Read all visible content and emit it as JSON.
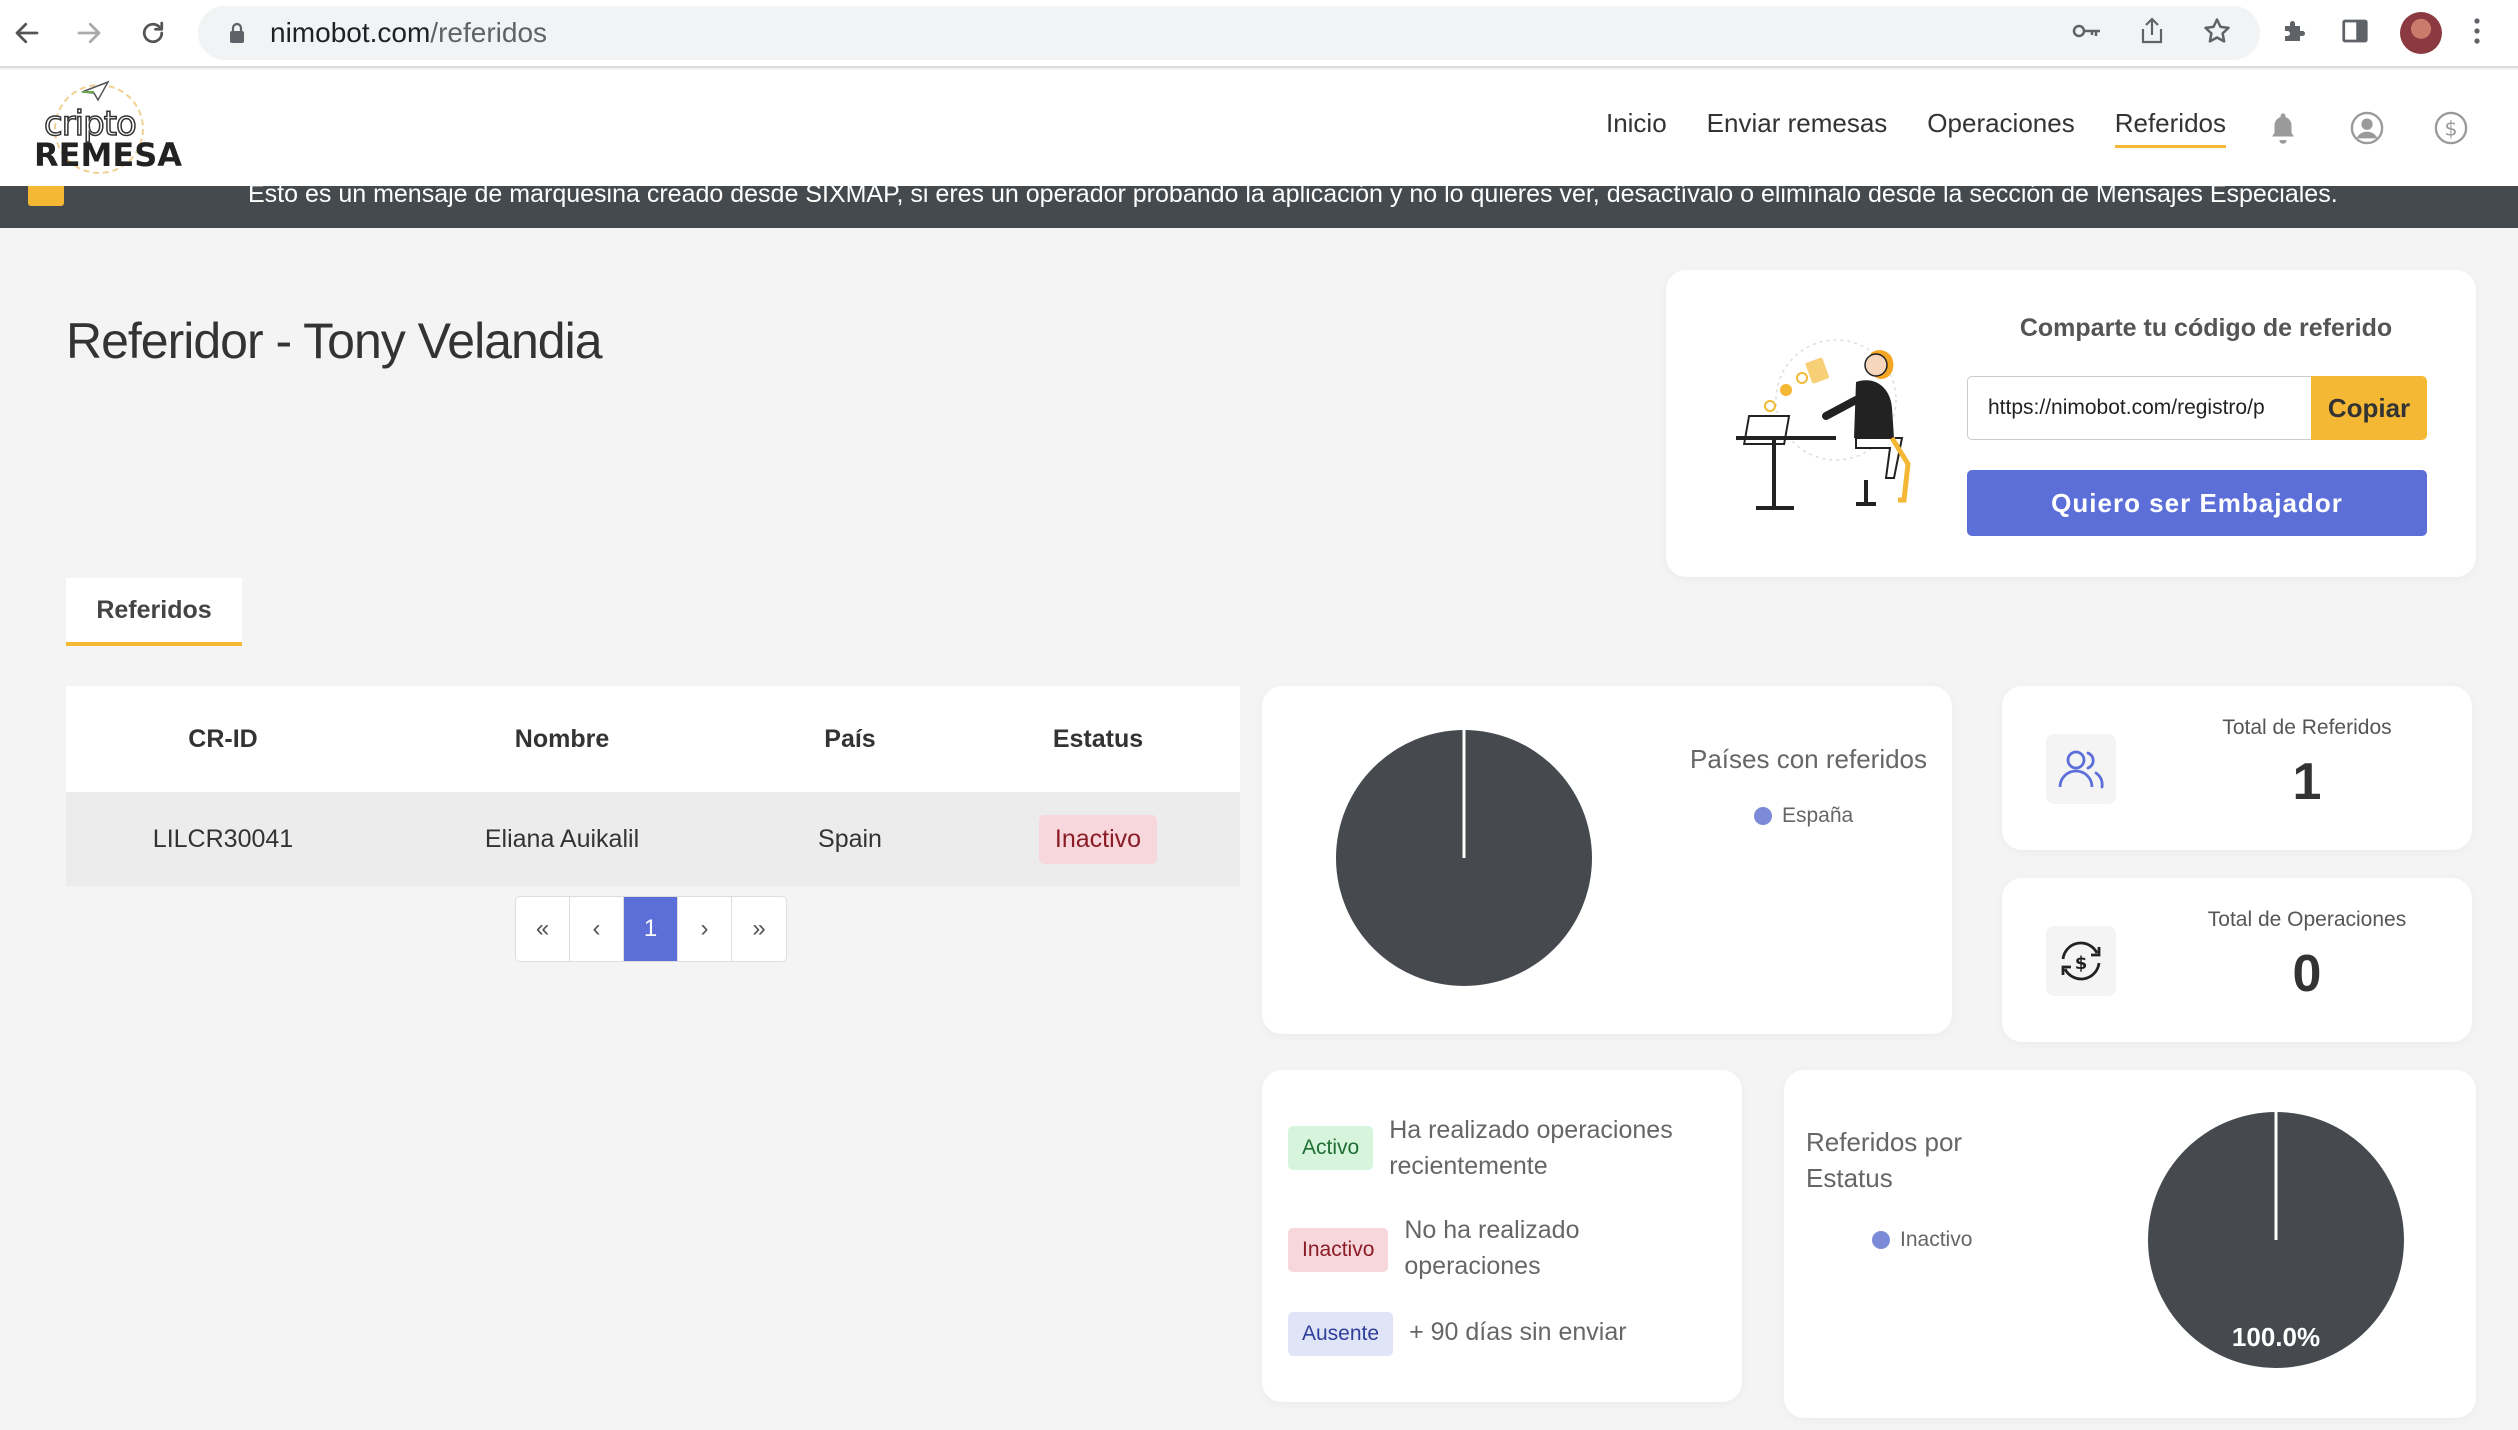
{
  "browser": {
    "url_domain": "nimobot.com",
    "url_path": "/referidos"
  },
  "site": {
    "logo_top": "cripto",
    "logo_bottom": "REMESA",
    "nav": [
      "Inicio",
      "Enviar remesas",
      "Operaciones",
      "Referidos"
    ],
    "active_nav": "Referidos"
  },
  "marquee": {
    "text": "Esto es un mensaje de marquesina creado desde SIXMAP, si eres un operador probando la aplicación y no lo quieres ver, desactívalo o elimínalo desde la sección de Mensajes Especiales."
  },
  "page": {
    "title": "Referidor - Tony Velandia"
  },
  "share": {
    "title": "Comparte tu código de referido",
    "link_value": "https://nimobot.com/registro/p",
    "copy_label": "Copiar",
    "ambassador_label": "Quiero ser Embajador"
  },
  "tabs": [
    "Referidos"
  ],
  "table": {
    "headers": [
      "CR-ID",
      "Nombre",
      "País",
      "Estatus"
    ],
    "rows": [
      {
        "id": "LILCR30041",
        "name": "Eliana Auikalil",
        "country": "Spain",
        "status": "Inactivo"
      }
    ]
  },
  "pagination": {
    "first": "«",
    "prev": "‹",
    "current": "1",
    "next": "›",
    "last": "»"
  },
  "countries_chart": {
    "title": "Países con referidos",
    "legend": [
      "España"
    ]
  },
  "stats": {
    "total_referidos_label": "Total de Referidos",
    "total_referidos_value": "1",
    "total_operaciones_label": "Total de Operaciones",
    "total_operaciones_value": "0"
  },
  "status_legend": [
    {
      "badge": "Activo",
      "text": "Ha realizado operaciones recientemente",
      "bg": "#d6f5dc",
      "fg": "#1f6e33"
    },
    {
      "badge": "Inactivo",
      "text": "No ha realizado operaciones",
      "bg": "#f7d7db",
      "fg": "#8a1c26"
    },
    {
      "badge": "Ausente",
      "text": "+ 90 días sin enviar",
      "bg": "#e0e4f7",
      "fg": "#2f3f99"
    }
  ],
  "status_chart": {
    "title": "Referidos por Estatus",
    "legend": [
      "Inactivo"
    ],
    "label": "100.0%"
  },
  "colors": {
    "accent": "#f5b835",
    "primary": "#5c6fd9",
    "pie_fill": "#464a4e",
    "legend_dot": "#7d8ad8"
  },
  "chart_data": [
    {
      "type": "pie",
      "title": "Países con referidos",
      "categories": [
        "España"
      ],
      "values": [
        1
      ]
    },
    {
      "type": "pie",
      "title": "Referidos por Estatus",
      "categories": [
        "Inactivo"
      ],
      "values": [
        100.0
      ]
    }
  ]
}
